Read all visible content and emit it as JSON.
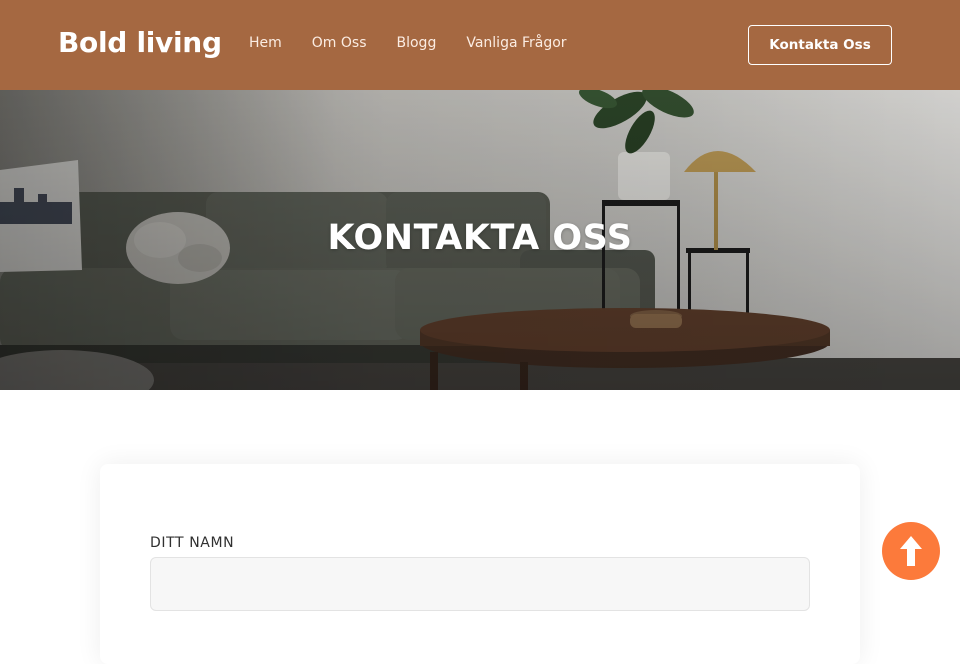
{
  "header": {
    "logo": "Bold living",
    "nav": [
      "Hem",
      "Om Oss",
      "Blogg",
      "Vanliga Frågor"
    ],
    "cta_label": "Kontakta Oss"
  },
  "hero": {
    "title": "KONTAKTA OSS",
    "image": "living-room-sofa-photo"
  },
  "form": {
    "name_label": "DITT NAMN",
    "name_value": "",
    "name_placeholder": ""
  },
  "scroll_top": {
    "icon": "arrow-up-icon"
  },
  "colors": {
    "header_bg": "#a56841",
    "accent": "#fc7a3b",
    "text_dark": "#303030",
    "white": "#ffffff"
  }
}
